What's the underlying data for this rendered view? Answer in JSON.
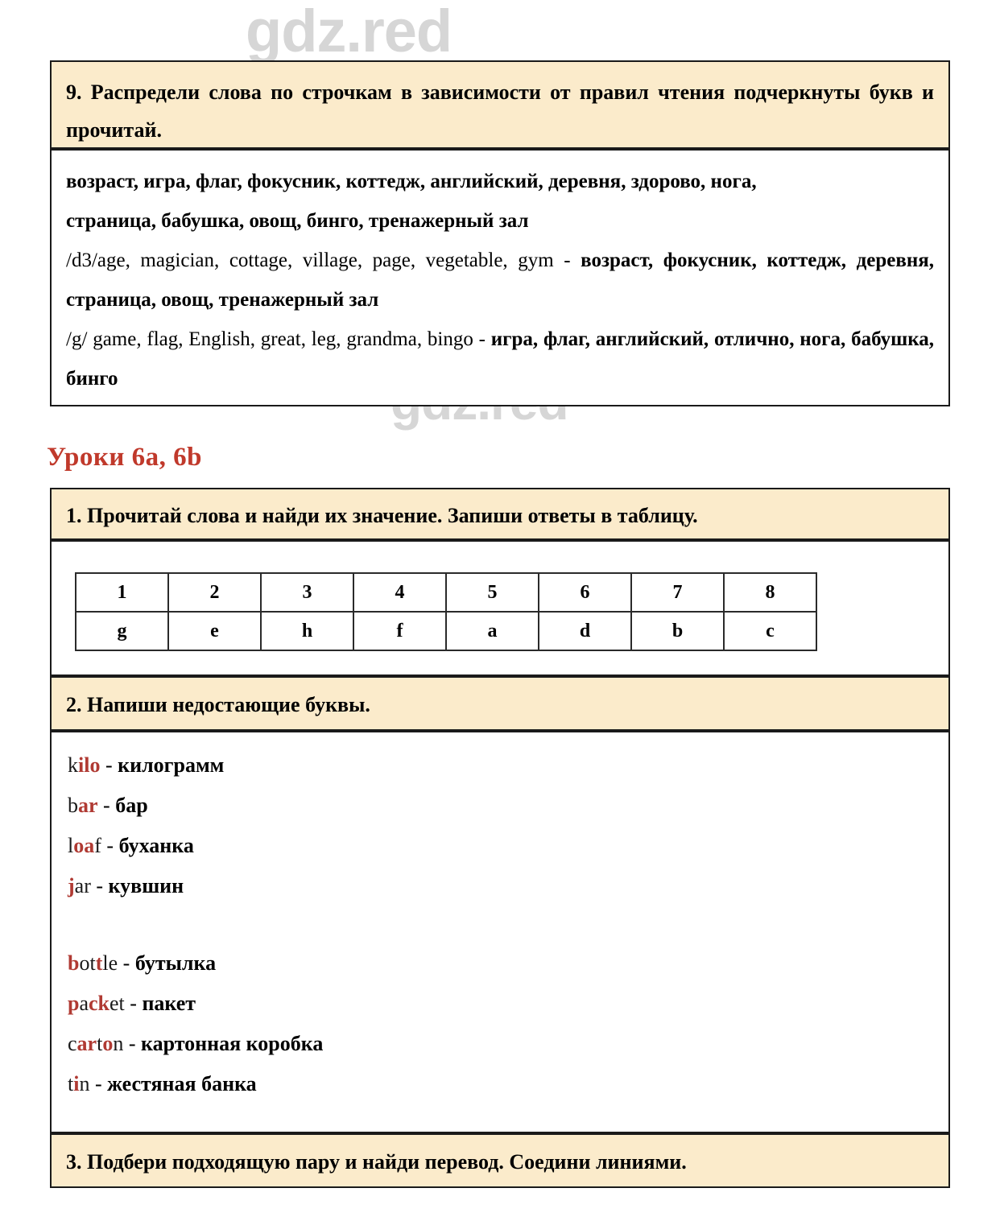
{
  "watermark": {
    "text": "gdz.red"
  },
  "exercise9": {
    "prompt": "9. Распредели слова по строчкам в зависимости от правил чтения подчеркнуты букв и прочитай.",
    "word_list_line1": "возраст, игра, флаг, фокусник, коттедж, английский, деревня, здорово, нога,",
    "word_list_line2": "страница, бабушка, овощ, бинго, тренажерный зал",
    "answers": [
      {
        "english": "/d3/age,  magician, cottage, village, page, vegetable, gym - ",
        "russian": "возраст, фокусник, коттедж, деревня, страница, овощ, тренажерный зал"
      },
      {
        "english": "/g/ game,  flag, English, great, leg, grandma, bingo - ",
        "russian": "игра, флаг, английский, отлично, нога, бабушка, бинго"
      }
    ]
  },
  "section": {
    "heading": "Уроки 6a, 6b",
    "heading_color": "#c0392b"
  },
  "exercise1": {
    "prompt": "1. Прочитай слова и найди их значение. Запиши ответы в таблицу.",
    "table": {
      "numbers": [
        "1",
        "2",
        "3",
        "4",
        "5",
        "6",
        "7",
        "8"
      ],
      "letters": [
        "g",
        "e",
        "h",
        "f",
        "a",
        "d",
        "b",
        "c"
      ]
    }
  },
  "exercise2": {
    "prompt": "2. Напиши недостающие буквы.",
    "highlight_color": "#b03a33",
    "group1": [
      {
        "parts": [
          {
            "t": "k",
            "hl": false
          },
          {
            "t": "ilo",
            "hl": true
          }
        ],
        "dash": " - ",
        "translation": "килограмм"
      },
      {
        "parts": [
          {
            "t": "b",
            "hl": false
          },
          {
            "t": "ar",
            "hl": true
          }
        ],
        "dash": " - ",
        "translation": "бар"
      },
      {
        "parts": [
          {
            "t": "l",
            "hl": false
          },
          {
            "t": "oa",
            "hl": true
          },
          {
            "t": "f",
            "hl": false
          }
        ],
        "dash": " - ",
        "translation": "буханка"
      },
      {
        "parts": [
          {
            "t": "j",
            "hl": true
          },
          {
            "t": "ar",
            "hl": false
          }
        ],
        "dash": " - ",
        "translation": "кувшин"
      }
    ],
    "group2": [
      {
        "parts": [
          {
            "t": "b",
            "hl": true
          },
          {
            "t": "ot",
            "hl": false
          },
          {
            "t": "t",
            "hl": true
          },
          {
            "t": "le",
            "hl": false
          }
        ],
        "dash": " - ",
        "translation": "бутылка"
      },
      {
        "parts": [
          {
            "t": "p",
            "hl": true
          },
          {
            "t": "a",
            "hl": false
          },
          {
            "t": "ck",
            "hl": true
          },
          {
            "t": "et",
            "hl": false
          }
        ],
        "dash": " - ",
        "translation": "пакет"
      },
      {
        "parts": [
          {
            "t": "c",
            "hl": false
          },
          {
            "t": "ar",
            "hl": true
          },
          {
            "t": "t",
            "hl": false
          },
          {
            "t": "o",
            "hl": true
          },
          {
            "t": "n",
            "hl": false
          }
        ],
        "dash": " - ",
        "translation": "картонная коробка"
      },
      {
        "parts": [
          {
            "t": "t",
            "hl": false
          },
          {
            "t": "i",
            "hl": true
          },
          {
            "t": "n",
            "hl": false
          }
        ],
        "dash": " - ",
        "translation": "жестяная банка"
      }
    ]
  },
  "exercise3": {
    "prompt": "3. Подбери подходящую пару и найди перевод. Соедини линиями."
  }
}
